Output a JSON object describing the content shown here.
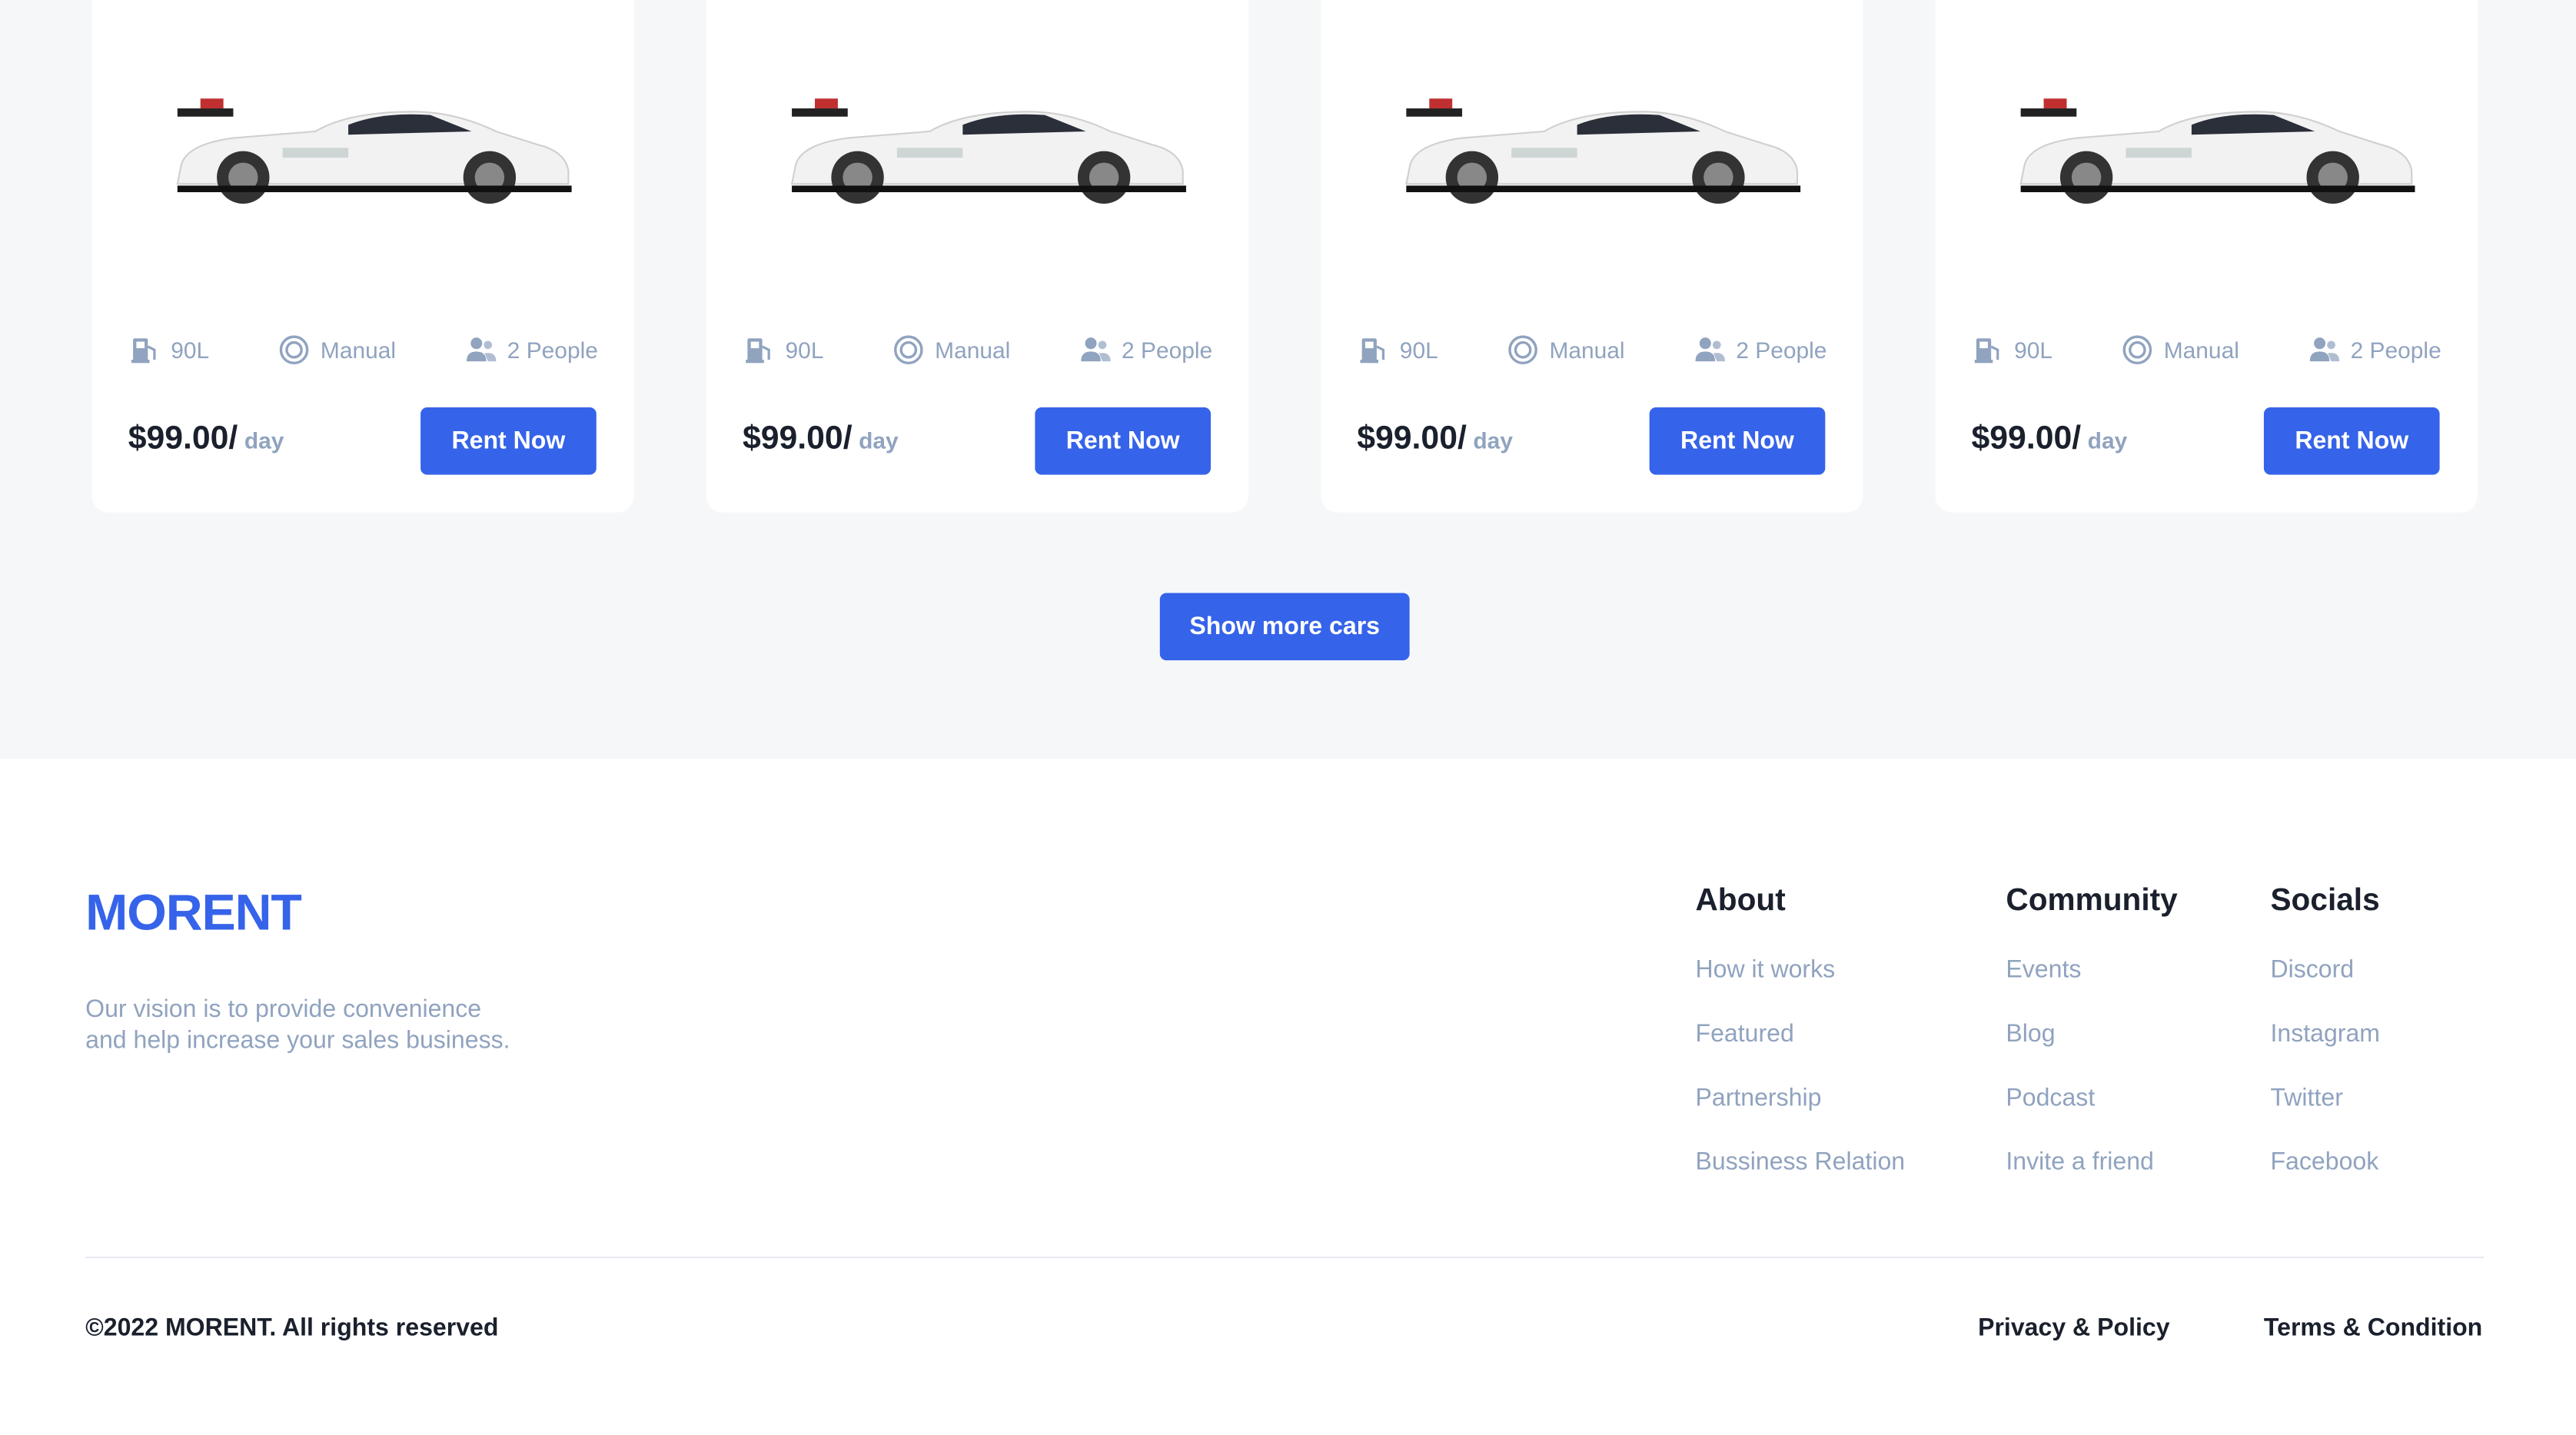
{
  "cars": [
    {
      "fuel": "90L",
      "transmission": "Manual",
      "capacity": "2 People",
      "price": "$99.00/",
      "unit": "day",
      "cta": "Rent Now"
    },
    {
      "fuel": "90L",
      "transmission": "Manual",
      "capacity": "2 People",
      "price": "$99.00/",
      "unit": "day",
      "cta": "Rent Now"
    },
    {
      "fuel": "90L",
      "transmission": "Manual",
      "capacity": "2 People",
      "price": "$99.00/",
      "unit": "day",
      "cta": "Rent Now"
    },
    {
      "fuel": "90L",
      "transmission": "Manual",
      "capacity": "2 People",
      "price": "$99.00/",
      "unit": "day",
      "cta": "Rent Now"
    }
  ],
  "show_more_label": "Show more cars",
  "footer": {
    "logo": "MORENT",
    "vision_line1": "Our vision is to provide convenience",
    "vision_line2": "and help increase your sales business.",
    "columns": [
      {
        "title": "About",
        "links": [
          "How it works",
          "Featured",
          "Partnership",
          "Bussiness Relation"
        ]
      },
      {
        "title": "Community",
        "links": [
          "Events",
          "Blog",
          "Podcast",
          "Invite a friend"
        ]
      },
      {
        "title": "Socials",
        "links": [
          "Discord",
          "Instagram",
          "Twitter",
          "Facebook"
        ]
      }
    ],
    "copyright": "©2022 MORENT. All rights reserved",
    "privacy": "Privacy & Policy",
    "terms": "Terms & Condition"
  },
  "colors": {
    "accent": "#3563e9",
    "muted": "#90a3bf",
    "text": "#1a202c",
    "bg": "#f6f7f9"
  }
}
